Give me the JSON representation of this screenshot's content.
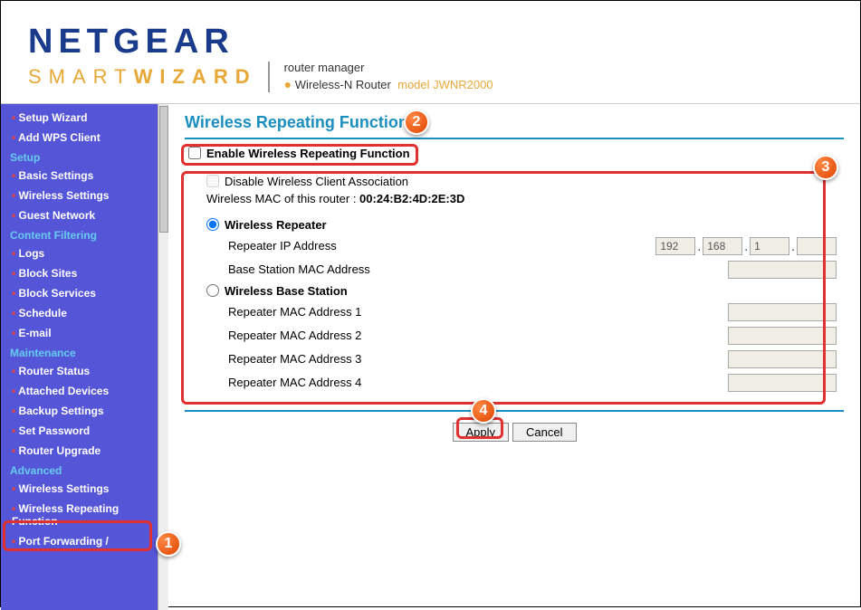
{
  "header": {
    "brand": "NETGEAR",
    "subbrand_smart": "SMART",
    "subbrand_wizard": "WIZARD",
    "tagline1": "router manager",
    "tagline2_prefix": "Wireless-N Router",
    "tagline2_model": "model JWNR2000"
  },
  "sidebar": {
    "items": [
      {
        "type": "item",
        "label": "Setup Wizard"
      },
      {
        "type": "item",
        "label": "Add WPS Client"
      },
      {
        "type": "section",
        "label": "Setup"
      },
      {
        "type": "item",
        "label": "Basic Settings"
      },
      {
        "type": "item",
        "label": "Wireless Settings"
      },
      {
        "type": "item",
        "label": "Guest Network"
      },
      {
        "type": "section",
        "label": "Content Filtering"
      },
      {
        "type": "item",
        "label": "Logs"
      },
      {
        "type": "item",
        "label": "Block Sites"
      },
      {
        "type": "item",
        "label": "Block Services"
      },
      {
        "type": "item",
        "label": "Schedule"
      },
      {
        "type": "item",
        "label": "E-mail"
      },
      {
        "type": "section",
        "label": "Maintenance"
      },
      {
        "type": "item",
        "label": "Router Status"
      },
      {
        "type": "item",
        "label": "Attached Devices"
      },
      {
        "type": "item",
        "label": "Backup Settings"
      },
      {
        "type": "item",
        "label": "Set Password"
      },
      {
        "type": "item",
        "label": "Router Upgrade"
      },
      {
        "type": "section",
        "label": "Advanced"
      },
      {
        "type": "item",
        "label": "Wireless Settings"
      },
      {
        "type": "item",
        "label": "Wireless Repeating Function"
      },
      {
        "type": "item",
        "label": "Port Forwarding /"
      }
    ]
  },
  "content": {
    "page_title": "Wireless Repeating Function",
    "enable_label": "Enable Wireless Repeating Function",
    "disable_label": "Disable Wireless Client Association",
    "mac_prefix": "Wireless MAC of this router : ",
    "mac_value": "00:24:B2:4D:2E:3D",
    "radio_repeater": "Wireless Repeater",
    "repeater_ip_label": "Repeater IP Address",
    "repeater_ip": {
      "a": "192",
      "b": "168",
      "c": "1",
      "d": ""
    },
    "base_mac_label": "Base Station MAC Address",
    "radio_base": "Wireless Base Station",
    "rep_mac1": "Repeater MAC Address 1",
    "rep_mac2": "Repeater MAC Address 2",
    "rep_mac3": "Repeater MAC Address 3",
    "rep_mac4": "Repeater MAC Address 4",
    "apply": "Apply",
    "cancel": "Cancel"
  },
  "badges": {
    "b1": "1",
    "b2": "2",
    "b3": "3",
    "b4": "4"
  }
}
